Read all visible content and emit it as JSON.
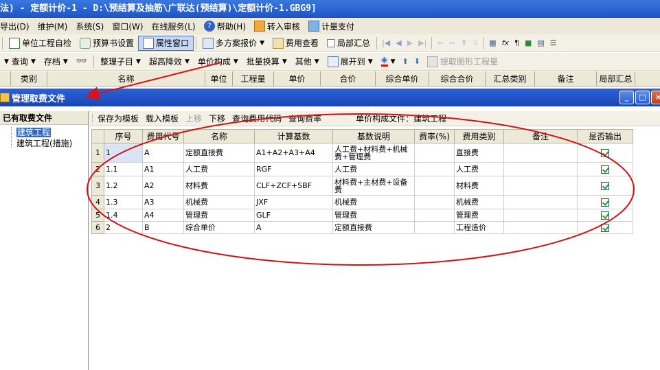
{
  "window": {
    "title": "法) - 定额计价-1 - D:\\预结算及抽筋\\广联达(预结算)\\定额计价-1.GBG9]"
  },
  "menu": [
    {
      "label": "导出(D)",
      "icon": ""
    },
    {
      "label": "维护(M)",
      "icon": ""
    },
    {
      "label": "系统(S)",
      "icon": ""
    },
    {
      "label": "窗口(W)",
      "icon": ""
    },
    {
      "label": "在线服务(L)",
      "icon": ""
    },
    {
      "label": "帮助(H)",
      "icon": "help-icon"
    },
    {
      "label": "转入审核",
      "icon": "transfer-icon"
    },
    {
      "label": "计量支付",
      "icon": "pay-icon"
    }
  ],
  "toolbar1": {
    "unit_check": "单位工程自检",
    "budget_settings": "预算书设置",
    "property_window": "属性窗口",
    "multi_quote": "多方案报价",
    "fee_view": "费用查看",
    "partial_summary": "局部汇总"
  },
  "toolbar2": {
    "query": "查询",
    "save": "存档",
    "sort_sub": "整理子目",
    "lower_cost": "超高降效",
    "unit_composition": "单价构成",
    "batch_convert": "批量换算",
    "other": "其他",
    "expand_to": "展开到",
    "extract_quantity": "提取图形工程量"
  },
  "columns": [
    "类别",
    "名称",
    "单位",
    "工程量",
    "单价",
    "合价",
    "综合单价",
    "综合合价",
    "汇总类别",
    "备注",
    "局部汇总"
  ],
  "panel": {
    "title": "管理取费文件"
  },
  "left": {
    "title": "已有取费文件",
    "items": [
      "建筑工程",
      "建筑工程(措施)"
    ]
  },
  "subtoolbar": {
    "save_template": "保存为模板",
    "load_template": "载入模板",
    "move_up": "上移",
    "move_down": "下移",
    "query_code": "查询费用代码",
    "query_rate": "查询费率",
    "composition_file": "单价构成文件：建筑工程"
  },
  "grid": {
    "headers": [
      "序号",
      "费用代号",
      "名称",
      "计算基数",
      "基数说明",
      "费率(%)",
      "费用类别",
      "备注",
      "是否输出"
    ],
    "rows": [
      {
        "rn": "1",
        "seq": "1",
        "code": "A",
        "name": "定额直接费",
        "base": "A1+A2+A3+A4",
        "desc": "人工费+材料费+机械费+管理费",
        "rate": "",
        "cat": "直接费",
        "note": ""
      },
      {
        "rn": "2",
        "seq": "1.1",
        "code": "A1",
        "name": "人工费",
        "base": "RGF",
        "desc": "人工费",
        "rate": "",
        "cat": "人工费",
        "note": ""
      },
      {
        "rn": "3",
        "seq": "1.2",
        "code": "A2",
        "name": "材料费",
        "base": "CLF+ZCF+SBF",
        "desc": "材料费+主材费+设备费",
        "rate": "",
        "cat": "材料费",
        "note": ""
      },
      {
        "rn": "4",
        "seq": "1.3",
        "code": "A3",
        "name": "机械费",
        "base": "JXF",
        "desc": "机械费",
        "rate": "",
        "cat": "机械费",
        "note": ""
      },
      {
        "rn": "5",
        "seq": "1.4",
        "code": "A4",
        "name": "管理费",
        "base": "GLF",
        "desc": "管理费",
        "rate": "",
        "cat": "管理费",
        "note": ""
      },
      {
        "rn": "6",
        "seq": "2",
        "code": "B",
        "name": "综合单价",
        "base": "A",
        "desc": "定额直接费",
        "rate": "",
        "cat": "工程造价",
        "note": ""
      }
    ]
  },
  "colors": {
    "annotation": "#e01010",
    "titlebar": "#1d54c6"
  }
}
